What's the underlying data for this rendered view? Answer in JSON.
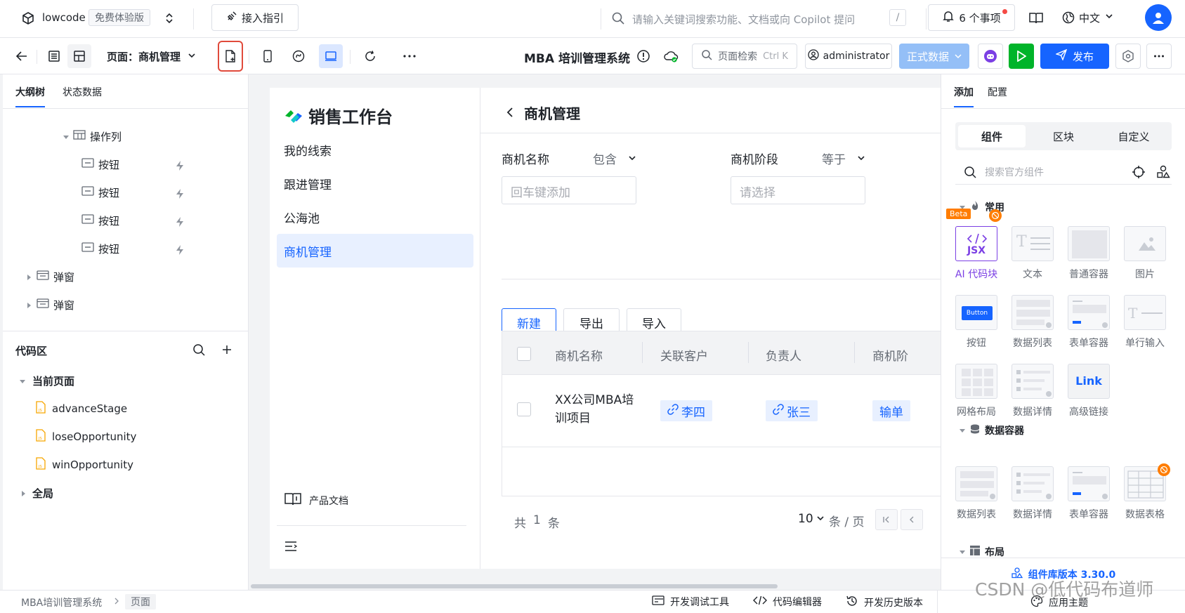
{
  "topbar": {
    "app_name": "lowcode",
    "plan_badge": "免费体验版",
    "guide_button": "接入指引",
    "search_placeholder": "请输入关键词搜索功能、文档或向 Copilot 提问",
    "search_shortcut": "/",
    "todo_label": "6 个事项",
    "language": "中文"
  },
  "toolbar": {
    "page_label": "页面：商机管理",
    "system_title": "MBA 培训管理系统",
    "page_search_label": "页面检索",
    "page_search_shortcut": "Ctrl K",
    "user": "administrator",
    "env_label": "正式数据",
    "publish_label": "发布"
  },
  "left_panel": {
    "tabs": [
      "大纲树",
      "状态数据"
    ],
    "tree": [
      {
        "label": "操作列",
        "icon": "table-icon"
      },
      {
        "label": "按钮",
        "icon": "button-icon"
      },
      {
        "label": "按钮",
        "icon": "button-icon"
      },
      {
        "label": "按钮",
        "icon": "button-icon"
      },
      {
        "label": "按钮",
        "icon": "button-icon"
      },
      {
        "label": "弹窗",
        "icon": "modal-icon"
      },
      {
        "label": "弹窗",
        "icon": "modal-icon"
      }
    ],
    "code_area": {
      "title": "代码区",
      "current_page_label": "当前页面",
      "files": [
        "advanceStage",
        "loseOpportunity",
        "winOpportunity"
      ],
      "global_label": "全局"
    }
  },
  "app_preview": {
    "brand": "销售工作台",
    "nav": [
      "我的线索",
      "跟进管理",
      "公海池",
      "商机管理"
    ],
    "active_nav": 3,
    "product_docs": "产品文档",
    "page_title": "商机管理",
    "filters": [
      {
        "label": "商机名称",
        "operator": "包含",
        "placeholder": "回车键添加"
      },
      {
        "label": "商机阶段",
        "operator": "等于",
        "placeholder": "请选择"
      }
    ],
    "actions": [
      "新建",
      "导出",
      "导入"
    ],
    "table_headers": [
      "商机名称",
      "关联客户",
      "负责人",
      "商机阶"
    ],
    "rows": [
      {
        "name_line1": "XX公司MBA培",
        "name_line2": "训项目",
        "customer": "李四",
        "owner": "张三",
        "stage": "输单"
      }
    ],
    "pagination": {
      "total_prefix": "共",
      "total": "1",
      "total_suffix": "条",
      "page_size": "10",
      "per_page_suffix": "条 / 页"
    }
  },
  "right_panel": {
    "tabs": [
      "添加",
      "配置"
    ],
    "segments": [
      "组件",
      "区块",
      "自定义"
    ],
    "search_placeholder": "搜索官方组件",
    "section_common": "常用",
    "section_data": "数据容器",
    "section_layout": "布局",
    "beta_badge": "Beta",
    "jsx_text": "JSX",
    "button_thumb_text": "Button",
    "link_thumb_text": "Link",
    "common": [
      "AI 代码块",
      "文本",
      "普通容器",
      "图片",
      "按钮",
      "数据列表",
      "表单容器",
      "单行输入",
      "网格布局",
      "数据详情",
      "高级链接"
    ],
    "data_containers": [
      "数据列表",
      "数据详情",
      "表单容器",
      "数据表格"
    ],
    "version": "组件库版本 3.30.0"
  },
  "statusbar": {
    "breadcrumb": [
      "MBA培训管理系统",
      "页面"
    ],
    "items": [
      "开发调试工具",
      "代码编辑器",
      "开发历史版本",
      "应用主题"
    ]
  },
  "watermark": "CSDN @低代码布道师",
  "colors": {
    "primary": "#1664ff",
    "env": "#94bff7",
    "run": "#00b42a",
    "ai": "#7b3fe4",
    "highlight": "#e04a3b"
  }
}
